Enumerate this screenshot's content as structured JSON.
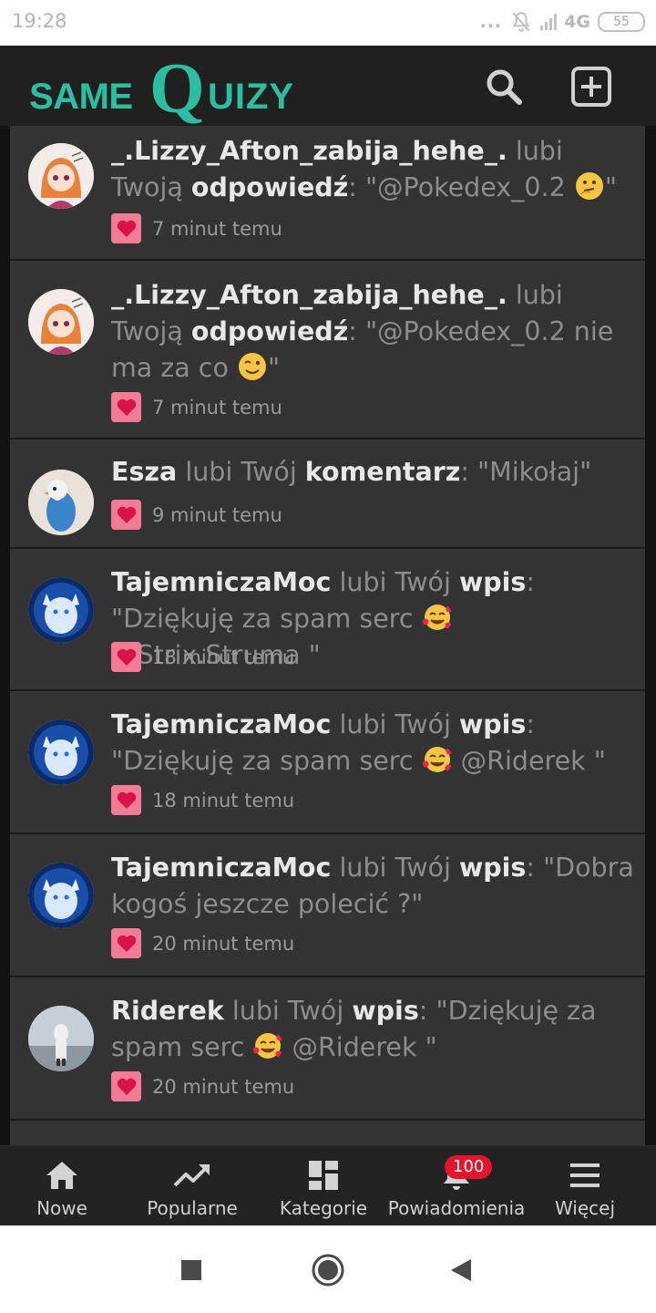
{
  "status_bar": {
    "time": "19:28",
    "dots": "...",
    "network": "4G",
    "battery": "55"
  },
  "header": {
    "logo_part1": "same",
    "logo_part2": "Q",
    "logo_part3": "uizy",
    "brand_color": "#2bbea1",
    "search_icon": "search-icon",
    "add_icon": "add-square-icon"
  },
  "notifications": [
    {
      "user": "_.Lizzy_Afton_zabija_hehe_.",
      "verb": "lubi Twoją",
      "object": "odpowiedź",
      "quote_prefix": ": \"@Pokedex_0.2 ",
      "emoji": "thinking-face",
      "quote_suffix": "\"",
      "time": "7 minut temu",
      "avatar": "anime-girl-avatar"
    },
    {
      "user": "_.Lizzy_Afton_zabija_hehe_.",
      "verb": "lubi Twoją",
      "object": "odpowiedź",
      "quote_prefix": ": \"@Pokedex_0.2 nie ma za co ",
      "emoji": "winking-face",
      "quote_suffix": "\"",
      "time": "7 minut temu",
      "avatar": "anime-girl-avatar"
    },
    {
      "user": "Esza",
      "verb": "lubi Twój",
      "object": "komentarz",
      "quote_prefix": ": \"Mikołaj\"",
      "emoji": "",
      "quote_suffix": "",
      "time": "9 minut temu",
      "avatar": "budgie-avatar"
    },
    {
      "user": "TajemniczaMoc",
      "verb": "lubi Twój",
      "object": "wpis",
      "quote_prefix": ": \"Dziękuję za spam serc ",
      "emoji": "smiling-face-with-hearts",
      "quote_suffix": " @Strix.Struma \"",
      "time": "18 minut temu",
      "avatar": "blue-cat-avatar"
    },
    {
      "user": "TajemniczaMoc",
      "verb": "lubi Twój",
      "object": "wpis",
      "quote_prefix": ": \"Dziękuję za spam serc ",
      "emoji": "smiling-face-with-hearts",
      "quote_suffix": " @Riderek \"",
      "time": "18 minut temu",
      "avatar": "blue-cat-avatar"
    },
    {
      "user": "TajemniczaMoc",
      "verb": "lubi Twój",
      "object": "wpis",
      "quote_prefix": ": \"Dobra kogoś jeszcze polecić ?\"",
      "emoji": "",
      "quote_suffix": "",
      "time": "20 minut temu",
      "avatar": "blue-cat-avatar"
    },
    {
      "user": "Riderek",
      "verb": "lubi Twój",
      "object": "wpis",
      "quote_prefix": ": \"Dziękuję za spam serc ",
      "emoji": "smiling-face-with-hearts",
      "quote_suffix": " @Riderek \"",
      "time": "20 minut temu",
      "avatar": "person-photo-avatar"
    }
  ],
  "bottom_nav": {
    "items": [
      {
        "label": "Nowe",
        "icon": "home-icon"
      },
      {
        "label": "Popularne",
        "icon": "trending-icon"
      },
      {
        "label": "Kategorie",
        "icon": "grid-icon"
      },
      {
        "label": "Powiadomienia",
        "icon": "bell-icon",
        "badge": "100"
      },
      {
        "label": "Więcej",
        "icon": "menu-icon"
      }
    ]
  },
  "colors": {
    "card_bg": "#333333",
    "heart_badge": "#f27c96",
    "badge_red": "#e3142b"
  }
}
